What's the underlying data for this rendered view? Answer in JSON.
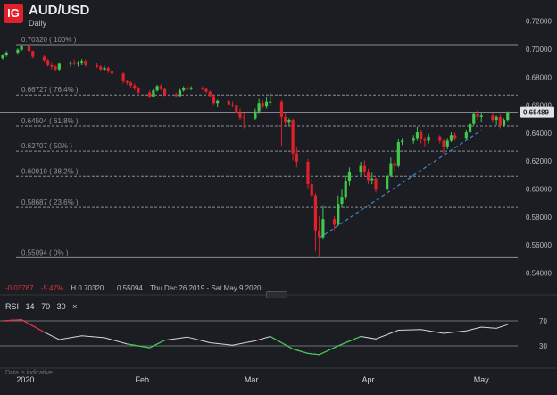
{
  "header": {
    "logo": "IG",
    "title": "AUD/USD",
    "subtitle": "Daily"
  },
  "ohlc": {
    "change": "-0.03787",
    "change_pct": "-5.47%",
    "high": "H 0.70320",
    "low": "L 0.55094",
    "range": "Thu Dec 26 2019 - Sat May 9 2020"
  },
  "rsi": {
    "label": "RSI",
    "p1": "14",
    "p2": "70",
    "p3": "30",
    "close": "×",
    "levels": [
      70,
      30
    ]
  },
  "disclaimer": "Data is indicative",
  "colors": {
    "background": "#1b1d22",
    "up": "#3ec94d",
    "down": "#e0202a",
    "trendline": "#3a8ccf",
    "fib": "#8a8e95",
    "price_tag": "#dfe2e6"
  },
  "chart_data": [
    {
      "type": "candlestick",
      "title": "AUD/USD",
      "subtitle": "Daily",
      "x_labels": [
        "2020",
        "Feb",
        "Mar",
        "Apr",
        "May"
      ],
      "x_label_dates": [
        "2020-01-01",
        "2020-02-01",
        "2020-03-01",
        "2020-04-01",
        "2020-05-01"
      ],
      "x_start": "2019-12-26",
      "x_end": "2020-05-09",
      "ylim": [
        0.532,
        0.73
      ],
      "y_ticks": [
        "0.54000",
        "0.56000",
        "0.58000",
        "0.60000",
        "0.62000",
        "0.64000",
        "0.66000",
        "0.68000",
        "0.70000",
        "0.72000"
      ],
      "last_price": "0.65489",
      "fib_levels": [
        {
          "value": 0.7032,
          "label": "0.70320 ( 100% )"
        },
        {
          "value": 0.66727,
          "label": "0.66727 ( 76.4% )"
        },
        {
          "value": 0.64504,
          "label": "0.64504 ( 61.8% )"
        },
        {
          "value": 0.62707,
          "label": "0.62707 ( 50% )"
        },
        {
          "value": 0.6091,
          "label": "0.60910 ( 38.2% )"
        },
        {
          "value": 0.58687,
          "label": "0.58687 ( 23.6% )"
        },
        {
          "value": 0.55094,
          "label": "0.55094 ( 0% )"
        }
      ],
      "price_line": 0.65489,
      "trendline": {
        "from": [
          "2020-03-19",
          0.565
        ],
        "to": [
          "2020-05-01",
          0.642
        ]
      },
      "candles": [
        {
          "d": "2019-12-26",
          "o": 0.6935,
          "h": 0.6965,
          "l": 0.6925,
          "c": 0.6955
        },
        {
          "d": "2019-12-27",
          "o": 0.6955,
          "h": 0.6985,
          "l": 0.6945,
          "c": 0.6975
        },
        {
          "d": "2019-12-30",
          "o": 0.6975,
          "h": 0.7005,
          "l": 0.6965,
          "c": 0.6995
        },
        {
          "d": "2019-12-31",
          "o": 0.6995,
          "h": 0.7032,
          "l": 0.6985,
          "c": 0.702
        },
        {
          "d": "2020-01-02",
          "o": 0.702,
          "h": 0.703,
          "l": 0.6975,
          "c": 0.6985
        },
        {
          "d": "2020-01-03",
          "o": 0.6985,
          "h": 0.699,
          "l": 0.6935,
          "c": 0.6945
        },
        {
          "d": "2020-01-06",
          "o": 0.6945,
          "h": 0.696,
          "l": 0.691,
          "c": 0.692
        },
        {
          "d": "2020-01-07",
          "o": 0.692,
          "h": 0.693,
          "l": 0.6875,
          "c": 0.6885
        },
        {
          "d": "2020-01-08",
          "o": 0.6885,
          "h": 0.6905,
          "l": 0.6855,
          "c": 0.6875
        },
        {
          "d": "2020-01-09",
          "o": 0.6875,
          "h": 0.6885,
          "l": 0.6845,
          "c": 0.6855
        },
        {
          "d": "2020-01-10",
          "o": 0.6855,
          "h": 0.6905,
          "l": 0.6845,
          "c": 0.6895
        },
        {
          "d": "2020-01-13",
          "o": 0.6895,
          "h": 0.6915,
          "l": 0.6875,
          "c": 0.6905
        },
        {
          "d": "2020-01-14",
          "o": 0.6905,
          "h": 0.6925,
          "l": 0.6885,
          "c": 0.6895
        },
        {
          "d": "2020-01-15",
          "o": 0.6895,
          "h": 0.6915,
          "l": 0.6875,
          "c": 0.6905
        },
        {
          "d": "2020-01-16",
          "o": 0.6905,
          "h": 0.693,
          "l": 0.6885,
          "c": 0.6915
        },
        {
          "d": "2020-01-17",
          "o": 0.6915,
          "h": 0.6925,
          "l": 0.6875,
          "c": 0.6885
        },
        {
          "d": "2020-01-20",
          "o": 0.6885,
          "h": 0.69,
          "l": 0.6865,
          "c": 0.6875
        },
        {
          "d": "2020-01-21",
          "o": 0.6875,
          "h": 0.6885,
          "l": 0.6845,
          "c": 0.6855
        },
        {
          "d": "2020-01-22",
          "o": 0.6855,
          "h": 0.688,
          "l": 0.6845,
          "c": 0.6865
        },
        {
          "d": "2020-01-23",
          "o": 0.6865,
          "h": 0.6875,
          "l": 0.683,
          "c": 0.684
        },
        {
          "d": "2020-01-24",
          "o": 0.684,
          "h": 0.6855,
          "l": 0.6815,
          "c": 0.6825
        },
        {
          "d": "2020-01-27",
          "o": 0.6825,
          "h": 0.6835,
          "l": 0.6755,
          "c": 0.677
        },
        {
          "d": "2020-01-28",
          "o": 0.677,
          "h": 0.678,
          "l": 0.6745,
          "c": 0.676
        },
        {
          "d": "2020-01-29",
          "o": 0.676,
          "h": 0.677,
          "l": 0.6725,
          "c": 0.674
        },
        {
          "d": "2020-01-30",
          "o": 0.674,
          "h": 0.6755,
          "l": 0.6705,
          "c": 0.672
        },
        {
          "d": "2020-01-31",
          "o": 0.672,
          "h": 0.673,
          "l": 0.668,
          "c": 0.669
        },
        {
          "d": "2020-02-03",
          "o": 0.669,
          "h": 0.6705,
          "l": 0.665,
          "c": 0.666
        },
        {
          "d": "2020-02-04",
          "o": 0.666,
          "h": 0.6715,
          "l": 0.6655,
          "c": 0.6705
        },
        {
          "d": "2020-02-05",
          "o": 0.6705,
          "h": 0.6745,
          "l": 0.6695,
          "c": 0.6735
        },
        {
          "d": "2020-02-06",
          "o": 0.6735,
          "h": 0.675,
          "l": 0.6705,
          "c": 0.6715
        },
        {
          "d": "2020-02-07",
          "o": 0.6715,
          "h": 0.6725,
          "l": 0.6665,
          "c": 0.6675
        },
        {
          "d": "2020-02-10",
          "o": 0.6675,
          "h": 0.669,
          "l": 0.6655,
          "c": 0.6665
        },
        {
          "d": "2020-02-11",
          "o": 0.6665,
          "h": 0.6715,
          "l": 0.6655,
          "c": 0.6705
        },
        {
          "d": "2020-02-12",
          "o": 0.6705,
          "h": 0.6735,
          "l": 0.6695,
          "c": 0.6725
        },
        {
          "d": "2020-02-13",
          "o": 0.6725,
          "h": 0.674,
          "l": 0.6705,
          "c": 0.6715
        },
        {
          "d": "2020-02-14",
          "o": 0.6715,
          "h": 0.6735,
          "l": 0.6705,
          "c": 0.6725
        },
        {
          "d": "2020-02-17",
          "o": 0.6725,
          "h": 0.6735,
          "l": 0.6705,
          "c": 0.6715
        },
        {
          "d": "2020-02-18",
          "o": 0.6715,
          "h": 0.6725,
          "l": 0.6685,
          "c": 0.6695
        },
        {
          "d": "2020-02-19",
          "o": 0.6695,
          "h": 0.6705,
          "l": 0.6655,
          "c": 0.6665
        },
        {
          "d": "2020-02-20",
          "o": 0.6665,
          "h": 0.6675,
          "l": 0.6605,
          "c": 0.6615
        },
        {
          "d": "2020-02-21",
          "o": 0.6615,
          "h": 0.664,
          "l": 0.6585,
          "c": 0.663
        },
        {
          "d": "2020-02-24",
          "o": 0.663,
          "h": 0.664,
          "l": 0.6595,
          "c": 0.6605
        },
        {
          "d": "2020-02-25",
          "o": 0.6605,
          "h": 0.6625,
          "l": 0.6585,
          "c": 0.6595
        },
        {
          "d": "2020-02-26",
          "o": 0.6595,
          "h": 0.6605,
          "l": 0.6535,
          "c": 0.6545
        },
        {
          "d": "2020-02-27",
          "o": 0.6545,
          "h": 0.6575,
          "l": 0.6495,
          "c": 0.651
        },
        {
          "d": "2020-02-28",
          "o": 0.651,
          "h": 0.6545,
          "l": 0.6435,
          "c": 0.6505
        },
        {
          "d": "2020-03-02",
          "o": 0.6505,
          "h": 0.6575,
          "l": 0.6495,
          "c": 0.6555
        },
        {
          "d": "2020-03-03",
          "o": 0.6555,
          "h": 0.6645,
          "l": 0.6535,
          "c": 0.6615
        },
        {
          "d": "2020-03-04",
          "o": 0.6615,
          "h": 0.6635,
          "l": 0.6575,
          "c": 0.659
        },
        {
          "d": "2020-03-05",
          "o": 0.659,
          "h": 0.6655,
          "l": 0.6575,
          "c": 0.6625
        },
        {
          "d": "2020-03-06",
          "o": 0.6625,
          "h": 0.6685,
          "l": 0.6605,
          "c": 0.6625
        },
        {
          "d": "2020-03-09",
          "o": 0.6625,
          "h": 0.6635,
          "l": 0.631,
          "c": 0.6515
        },
        {
          "d": "2020-03-10",
          "o": 0.6515,
          "h": 0.654,
          "l": 0.6455,
          "c": 0.6475
        },
        {
          "d": "2020-03-11",
          "o": 0.6475,
          "h": 0.6505,
          "l": 0.6455,
          "c": 0.6495
        },
        {
          "d": "2020-03-12",
          "o": 0.6495,
          "h": 0.6505,
          "l": 0.6205,
          "c": 0.6255
        },
        {
          "d": "2020-03-13",
          "o": 0.6255,
          "h": 0.6305,
          "l": 0.6155,
          "c": 0.6195
        },
        {
          "d": "2020-03-16",
          "o": 0.6195,
          "h": 0.6215,
          "l": 0.6005,
          "c": 0.6035
        },
        {
          "d": "2020-03-17",
          "o": 0.6035,
          "h": 0.6075,
          "l": 0.5935,
          "c": 0.5955
        },
        {
          "d": "2020-03-18",
          "o": 0.5955,
          "h": 0.597,
          "l": 0.5555,
          "c": 0.5705
        },
        {
          "d": "2020-03-19",
          "o": 0.5705,
          "h": 0.5805,
          "l": 0.5509,
          "c": 0.5655
        },
        {
          "d": "2020-03-20",
          "o": 0.5655,
          "h": 0.5885,
          "l": 0.5645,
          "c": 0.5785
        },
        {
          "d": "2020-03-23",
          "o": 0.5785,
          "h": 0.5805,
          "l": 0.5705,
          "c": 0.5745
        },
        {
          "d": "2020-03-24",
          "o": 0.5745,
          "h": 0.5955,
          "l": 0.5735,
          "c": 0.5895
        },
        {
          "d": "2020-03-25",
          "o": 0.5895,
          "h": 0.5995,
          "l": 0.5865,
          "c": 0.5945
        },
        {
          "d": "2020-03-26",
          "o": 0.5945,
          "h": 0.6095,
          "l": 0.5925,
          "c": 0.6055
        },
        {
          "d": "2020-03-27",
          "o": 0.6055,
          "h": 0.6155,
          "l": 0.6025,
          "c": 0.6125
        },
        {
          "d": "2020-03-30",
          "o": 0.6125,
          "h": 0.6195,
          "l": 0.6095,
          "c": 0.6165
        },
        {
          "d": "2020-03-31",
          "o": 0.6165,
          "h": 0.6205,
          "l": 0.6095,
          "c": 0.6125
        },
        {
          "d": "2020-04-01",
          "o": 0.6125,
          "h": 0.6145,
          "l": 0.6035,
          "c": 0.6065
        },
        {
          "d": "2020-04-02",
          "o": 0.6065,
          "h": 0.6115,
          "l": 0.6035,
          "c": 0.6075
        },
        {
          "d": "2020-04-03",
          "o": 0.6075,
          "h": 0.6085,
          "l": 0.5975,
          "c": 0.5995
        },
        {
          "d": "2020-04-06",
          "o": 0.5995,
          "h": 0.6115,
          "l": 0.5985,
          "c": 0.6095
        },
        {
          "d": "2020-04-07",
          "o": 0.6095,
          "h": 0.6225,
          "l": 0.6085,
          "c": 0.6185
        },
        {
          "d": "2020-04-08",
          "o": 0.6185,
          "h": 0.6205,
          "l": 0.6125,
          "c": 0.6165
        },
        {
          "d": "2020-04-09",
          "o": 0.6165,
          "h": 0.6355,
          "l": 0.6155,
          "c": 0.6335
        },
        {
          "d": "2020-04-10",
          "o": 0.6335,
          "h": 0.6365,
          "l": 0.6315,
          "c": 0.6345
        },
        {
          "d": "2020-04-13",
          "o": 0.6345,
          "h": 0.6385,
          "l": 0.6325,
          "c": 0.6365
        },
        {
          "d": "2020-04-14",
          "o": 0.6365,
          "h": 0.6445,
          "l": 0.6345,
          "c": 0.6405
        },
        {
          "d": "2020-04-15",
          "o": 0.6405,
          "h": 0.6425,
          "l": 0.6325,
          "c": 0.6355
        },
        {
          "d": "2020-04-16",
          "o": 0.6355,
          "h": 0.6375,
          "l": 0.6305,
          "c": 0.6345
        },
        {
          "d": "2020-04-17",
          "o": 0.6345,
          "h": 0.6395,
          "l": 0.6325,
          "c": 0.6375
        },
        {
          "d": "2020-04-20",
          "o": 0.6375,
          "h": 0.6385,
          "l": 0.6325,
          "c": 0.6345
        },
        {
          "d": "2020-04-21",
          "o": 0.6345,
          "h": 0.6355,
          "l": 0.6255,
          "c": 0.6305
        },
        {
          "d": "2020-04-22",
          "o": 0.6305,
          "h": 0.6365,
          "l": 0.6285,
          "c": 0.6345
        },
        {
          "d": "2020-04-23",
          "o": 0.6345,
          "h": 0.6405,
          "l": 0.6335,
          "c": 0.6385
        },
        {
          "d": "2020-04-24",
          "o": 0.6385,
          "h": 0.6405,
          "l": 0.6345,
          "c": 0.6365
        },
        {
          "d": "2020-04-27",
          "o": 0.6365,
          "h": 0.6425,
          "l": 0.6355,
          "c": 0.6405
        },
        {
          "d": "2020-04-28",
          "o": 0.6405,
          "h": 0.6485,
          "l": 0.6395,
          "c": 0.6465
        },
        {
          "d": "2020-04-29",
          "o": 0.6465,
          "h": 0.6545,
          "l": 0.6455,
          "c": 0.6535
        },
        {
          "d": "2020-04-30",
          "o": 0.6535,
          "h": 0.6565,
          "l": 0.6495,
          "c": 0.6515
        },
        {
          "d": "2020-05-01",
          "o": 0.6515,
          "h": 0.6545,
          "l": 0.6475,
          "c": 0.6525
        },
        {
          "d": "2020-05-04",
          "o": 0.6525,
          "h": 0.6545,
          "l": 0.6475,
          "c": 0.6495
        },
        {
          "d": "2020-05-05",
          "o": 0.6495,
          "h": 0.6525,
          "l": 0.6455,
          "c": 0.6515
        },
        {
          "d": "2020-05-06",
          "o": 0.6515,
          "h": 0.6535,
          "l": 0.6435,
          "c": 0.6455
        },
        {
          "d": "2020-05-07",
          "o": 0.6455,
          "h": 0.6505,
          "l": 0.6445,
          "c": 0.6495
        },
        {
          "d": "2020-05-08",
          "o": 0.6495,
          "h": 0.6555,
          "l": 0.6485,
          "c": 0.6549
        }
      ]
    },
    {
      "type": "line",
      "title": "RSI",
      "ylim": [
        0,
        100
      ],
      "y_ticks": [
        "70",
        "30"
      ],
      "levels": [
        70,
        30
      ],
      "dates": [
        "2019-12-26",
        "2019-12-31",
        "2020-01-06",
        "2020-01-10",
        "2020-01-16",
        "2020-01-22",
        "2020-01-28",
        "2020-02-03",
        "2020-02-07",
        "2020-02-13",
        "2020-02-19",
        "2020-02-25",
        "2020-03-02",
        "2020-03-06",
        "2020-03-12",
        "2020-03-16",
        "2020-03-19",
        "2020-03-24",
        "2020-03-30",
        "2020-04-03",
        "2020-04-09",
        "2020-04-15",
        "2020-04-21",
        "2020-04-27",
        "2020-05-01",
        "2020-05-05",
        "2020-05-08"
      ],
      "values": [
        70,
        72,
        52,
        40,
        46,
        43,
        33,
        27,
        39,
        44,
        35,
        31,
        38,
        45,
        25,
        18,
        16,
        30,
        45,
        41,
        55,
        56,
        50,
        54,
        60,
        58,
        64
      ]
    }
  ]
}
